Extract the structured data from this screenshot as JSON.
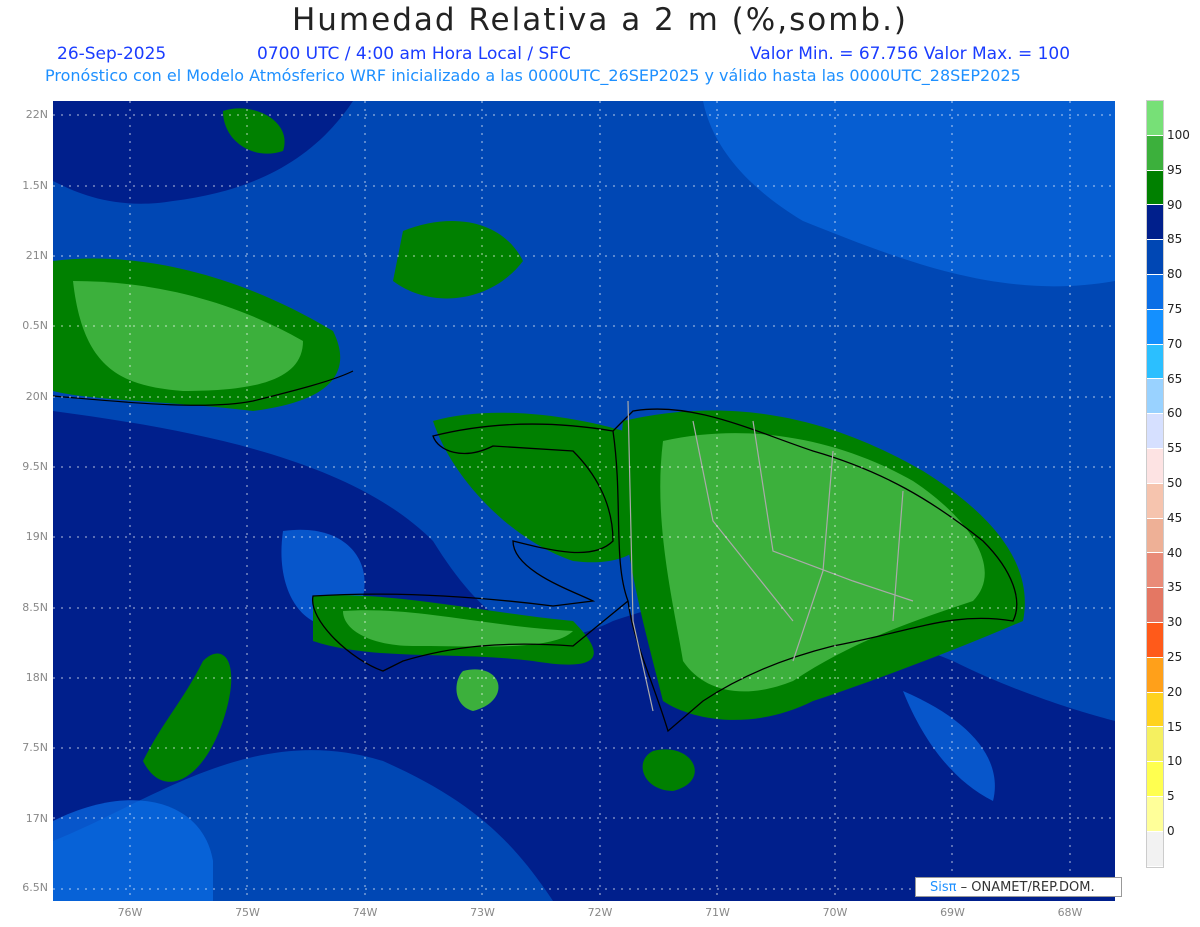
{
  "title": "Humedad Relativa a 2 m (%,somb.)",
  "header": {
    "date": "26-Sep-2025",
    "time": "0700 UTC / 4:00 am Hora Local / SFC",
    "minmax": "Valor Min. = 67.756  Valor Max. = 100",
    "subtitle": "Pronóstico con el Modelo Atmósferico WRF inicializado a las 0000UTC_26SEP2025 y válido hasta las  0000UTC_28SEP2025"
  },
  "lat_labels": [
    "22N",
    "1.5N",
    "21N",
    "0.5N",
    "20N",
    "9.5N",
    "19N",
    "8.5N",
    "18N",
    "7.5N",
    "17N",
    "6.5N"
  ],
  "lon_labels": [
    "76W",
    "75W",
    "74W",
    "73W",
    "72W",
    "71W",
    "70W",
    "69W",
    "68W"
  ],
  "colorbar": {
    "labels": [
      "100",
      "95",
      "90",
      "85",
      "80",
      "75",
      "70",
      "65",
      "60",
      "55",
      "50",
      "45",
      "40",
      "35",
      "30",
      "25",
      "20",
      "15",
      "10",
      "5",
      "0"
    ],
    "colors": [
      "#77e077",
      "#3cb03c",
      "#008000",
      "#001f8c",
      "#0047b4",
      "#0a6ee6",
      "#1490ff",
      "#2bbfff",
      "#99d2ff",
      "#d6e0ff",
      "#fde3e3",
      "#f6c4ae",
      "#eeb096",
      "#e98b78",
      "#e47763",
      "#ff5a1a",
      "#ffa01a",
      "#ffd21e",
      "#f5f060",
      "#ffff50",
      "#ffff99",
      "#f2f2f2"
    ]
  },
  "credit": {
    "brand": "Sisπ",
    "text": " –  ONAMET/REP.DOM."
  }
}
